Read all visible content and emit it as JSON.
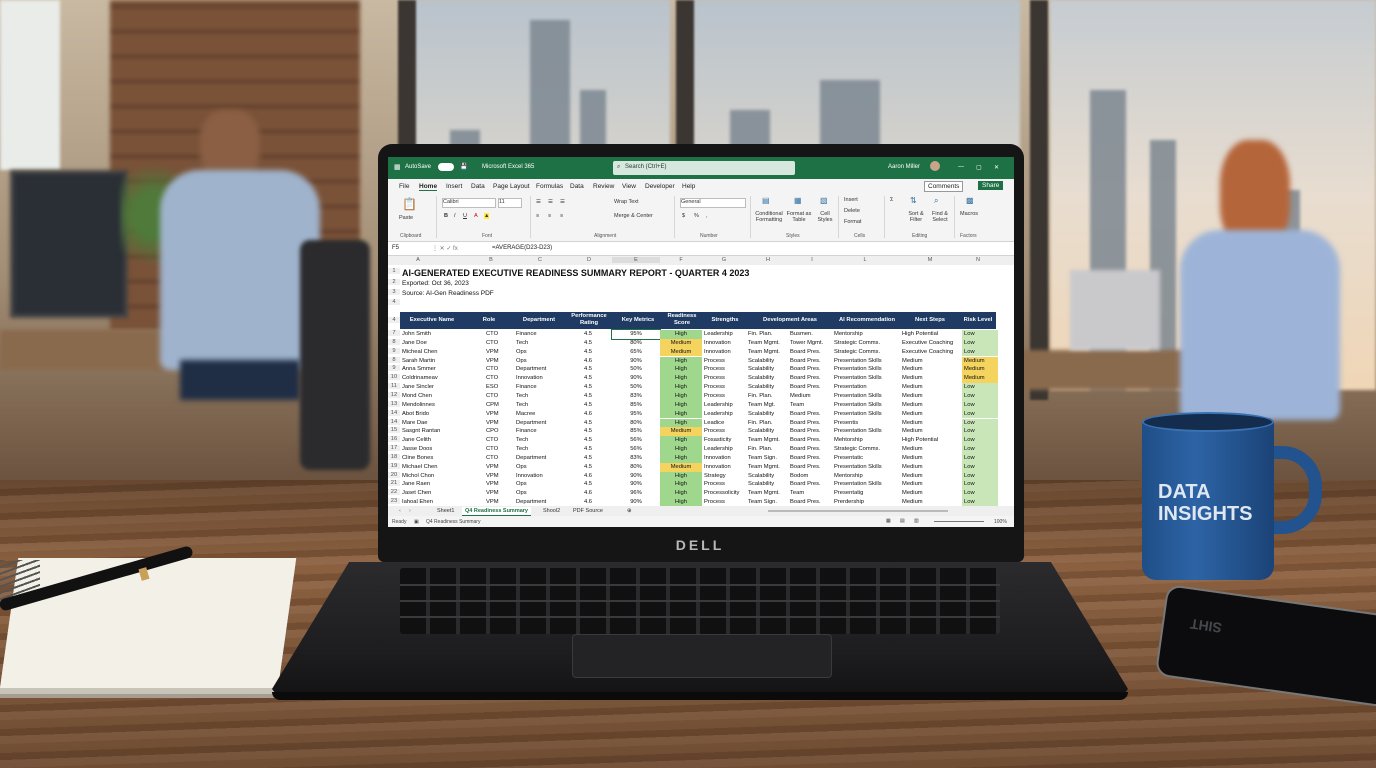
{
  "excel": {
    "autosave": "AutoSave",
    "app_name": "Microsoft Excel 365",
    "search": "Search (Ctrl+E)",
    "user": "Aaron Miller",
    "comments": "Comments",
    "share": "Share",
    "menu": [
      "File",
      "Home",
      "Insert",
      "Data",
      "Page Layout",
      "Formulas",
      "Data",
      "Review",
      "View",
      "Developer",
      "Help"
    ],
    "ribbon": {
      "paste": "Paste",
      "font_name": "Calibri",
      "font_size": "11",
      "wrap_text": "Wrap Text",
      "merge": "Merge & Center",
      "number_format": "General",
      "cond_format": "Conditional Formatting",
      "format_table": "Format as Table",
      "cell_styles": "Cell Styles",
      "insert": "Insert",
      "delete": "Delete",
      "format": "Format",
      "sort": "Sort & Filter",
      "find": "Find & Select",
      "macros": "Macros",
      "groups": [
        "Clipboard",
        "Font",
        "Alignment",
        "Number",
        "Styles",
        "Cells",
        "Editing",
        "Factors"
      ]
    },
    "name_box": "F5",
    "formula": "=AVERAGE(D23-D23)",
    "columns": [
      "A",
      "B",
      "C",
      "D",
      "E",
      "F",
      "G",
      "H",
      "I",
      "L",
      "M",
      "N"
    ],
    "sheet": {
      "title": "AI-GENERATED EXECUTIVE READINESS SUMMARY REPORT - QUARTER 4 2023",
      "exported": "Exported: Oct 36, 2023",
      "source": "Source: AI-Gen Readiness PDF",
      "headers": [
        "Executive Name",
        "Role",
        "Department",
        "Performance Rating",
        "Key Metrics",
        "Readiness Score",
        "Strengths",
        "Development Areas",
        "AI Recommendation",
        "Next Steps",
        "Risk Level"
      ],
      "rows": [
        {
          "n": "7",
          "name": "John Smith",
          "role": "CTO",
          "dept": "Finance",
          "perf": "4.5",
          "metric": "95%",
          "ready": "High",
          "str": "Leadership",
          "dev": "Fin. Plan.",
          "dev2": "Busmen.",
          "ai": "Mentorship",
          "next": "High Potential",
          "risk": "Low"
        },
        {
          "n": "8",
          "name": "Jane Doe",
          "role": "CTO",
          "dept": "Tech",
          "perf": "4.5",
          "metric": "80%",
          "ready": "Medium",
          "str": "Innovation",
          "dev": "Team Mgmt.",
          "dev2": "Tower Mgmt.",
          "ai": "Strategic Comms.",
          "next": "Executive Coaching",
          "risk": "Low"
        },
        {
          "n": "9",
          "name": "Micheal Chen",
          "role": "VPM",
          "dept": "Ops",
          "perf": "4.5",
          "metric": "65%",
          "ready": "Medium",
          "str": "Innovation",
          "dev": "Team Mgmt.",
          "dev2": "Board Pres.",
          "ai": "Strategic Comms.",
          "next": "Executive Coaching",
          "risk": "Low"
        },
        {
          "n": "8",
          "name": "Sarah Martin",
          "role": "VPM",
          "dept": "Ops",
          "perf": "4.6",
          "metric": "90%",
          "ready": "High",
          "str": "Process",
          "dev": "Scalability",
          "dev2": "Board Pres.",
          "ai": "Presentation Skills",
          "next": "Medium",
          "risk": "Medium"
        },
        {
          "n": "9",
          "name": "Anna Smmer",
          "role": "CTO",
          "dept": "Department",
          "perf": "4.5",
          "metric": "50%",
          "ready": "High",
          "str": "Process",
          "dev": "Scalability",
          "dev2": "Board Pres.",
          "ai": "Presentation Skills",
          "next": "Medium",
          "risk": "Medium"
        },
        {
          "n": "10",
          "name": "Coldrinameav",
          "role": "CTO",
          "dept": "Innovation",
          "perf": "4.5",
          "metric": "90%",
          "ready": "High",
          "str": "Process",
          "dev": "Scalability",
          "dev2": "Board Pres.",
          "ai": "Presentation Skills",
          "next": "Medium",
          "risk": "Medium"
        },
        {
          "n": "11",
          "name": "Jane Sincler",
          "role": "ESO",
          "dept": "Finance",
          "perf": "4.5",
          "metric": "50%",
          "ready": "High",
          "str": "Process",
          "dev": "Scalability",
          "dev2": "Board Pres.",
          "ai": "Presentation",
          "next": "Medium",
          "risk": "Low"
        },
        {
          "n": "12",
          "name": "Mond Chen",
          "role": "CTO",
          "dept": "Tech",
          "perf": "4.5",
          "metric": "83%",
          "ready": "High",
          "str": "Process",
          "dev": "Fin. Plan.",
          "dev2": "Medium",
          "ai": "Presentation Skills",
          "next": "Medium",
          "risk": "Low"
        },
        {
          "n": "13",
          "name": "Mendolinnes",
          "role": "CPM",
          "dept": "Tech",
          "perf": "4.5",
          "metric": "85%",
          "ready": "High",
          "str": "Leadership",
          "dev": "Team Mgt.",
          "dev2": "Team",
          "ai": "Presentation Skills",
          "next": "Medium",
          "risk": "Low"
        },
        {
          "n": "14",
          "name": "Abot Brido",
          "role": "VPM",
          "dept": "Macree",
          "perf": "4.6",
          "metric": "95%",
          "ready": "High",
          "str": "Leadership",
          "dev": "Scalability",
          "dev2": "Board Pres.",
          "ai": "Presentation Skills",
          "next": "Medium",
          "risk": "Low"
        },
        {
          "n": "14",
          "name": "Mare Dae",
          "role": "VPM",
          "dept": "Department",
          "perf": "4.5",
          "metric": "80%",
          "ready": "High",
          "str": "Leadice",
          "dev": "Fin. Plan.",
          "dev2": "Board Pres.",
          "ai": "Presentis",
          "next": "Medium",
          "risk": "Low"
        },
        {
          "n": "15",
          "name": "Sasgnt Rantan",
          "role": "CPO",
          "dept": "Finance",
          "perf": "4.5",
          "metric": "85%",
          "ready": "Medium",
          "str": "Process",
          "dev": "Scalability",
          "dev2": "Board Pres.",
          "ai": "Presentation Skills",
          "next": "Medium",
          "risk": "Low"
        },
        {
          "n": "16",
          "name": "Jane Celith",
          "role": "CTO",
          "dept": "Tech",
          "perf": "4.5",
          "metric": "56%",
          "ready": "High",
          "str": "Fosasticity",
          "dev": "Team Mgmt.",
          "dev2": "Board Pres.",
          "ai": "Mehtorship",
          "next": "High Potential",
          "risk": "Low"
        },
        {
          "n": "17",
          "name": "Jasse Doos",
          "role": "CTO",
          "dept": "Tech",
          "perf": "4.5",
          "metric": "56%",
          "ready": "High",
          "str": "Leadership",
          "dev": "Fin. Plan.",
          "dev2": "Board Pres.",
          "ai": "Strategic Comms.",
          "next": "Medium",
          "risk": "Low"
        },
        {
          "n": "18",
          "name": "Cline Bones",
          "role": "CTO",
          "dept": "Department",
          "perf": "4.5",
          "metric": "83%",
          "ready": "High",
          "str": "Innovation",
          "dev": "Team Sign.",
          "dev2": "Board Pres.",
          "ai": "Presentatic",
          "next": "Medium",
          "risk": "Low"
        },
        {
          "n": "19",
          "name": "Michael Chen",
          "role": "VPM",
          "dept": "Ops",
          "perf": "4.5",
          "metric": "80%",
          "ready": "Medium",
          "str": "Innovation",
          "dev": "Team Mgmt.",
          "dev2": "Board Pres.",
          "ai": "Presentation Skills",
          "next": "Medium",
          "risk": "Low"
        },
        {
          "n": "20",
          "name": "Michol Chon",
          "role": "VPM",
          "dept": "Innovation",
          "perf": "4.6",
          "metric": "90%",
          "ready": "High",
          "str": "Strategy",
          "dev": "Scalability",
          "dev2": "Bodom",
          "ai": "Mentorship",
          "next": "Medium",
          "risk": "Low"
        },
        {
          "n": "21",
          "name": "Jane Raen",
          "role": "VPM",
          "dept": "Ops",
          "perf": "4.5",
          "metric": "90%",
          "ready": "High",
          "str": "Process",
          "dev": "Scalability",
          "dev2": "Board Pres.",
          "ai": "Presentation Skills",
          "next": "Medium",
          "risk": "Low"
        },
        {
          "n": "22",
          "name": "Jaset Chen",
          "role": "VPM",
          "dept": "Ops",
          "perf": "4.6",
          "metric": "96%",
          "ready": "High",
          "str": "Processolicity",
          "dev": "Team Mgmt.",
          "dev2": "Team",
          "ai": "Presentatig",
          "next": "Medium",
          "risk": "Low"
        },
        {
          "n": "23",
          "name": "Iahoal Ehen",
          "role": "VPM",
          "dept": "Department",
          "perf": "4.6",
          "metric": "90%",
          "ready": "High",
          "str": "Process",
          "dev": "Team Sign.",
          "dev2": "Board Pres.",
          "ai": "Prerdership",
          "next": "Medium",
          "risk": "Low"
        }
      ]
    },
    "sheet_tabs": [
      "Sheet1",
      "Q4 Readiness Summary",
      "Shool2",
      "PDF Source"
    ],
    "status_left": "Ready",
    "status_mid": "Q4 Readiness Summary",
    "zoom": "100%",
    "colors": {
      "high": "#9fd88d",
      "medium": "#f4d35e",
      "low": "#c8e6b8",
      "header": "#1f3b63",
      "excel_green": "#1e7145"
    }
  },
  "scene": {
    "laptop_logo": "DELL",
    "mug_text": "DATA INSIGHTS",
    "phone_reflection": "SIHT"
  }
}
